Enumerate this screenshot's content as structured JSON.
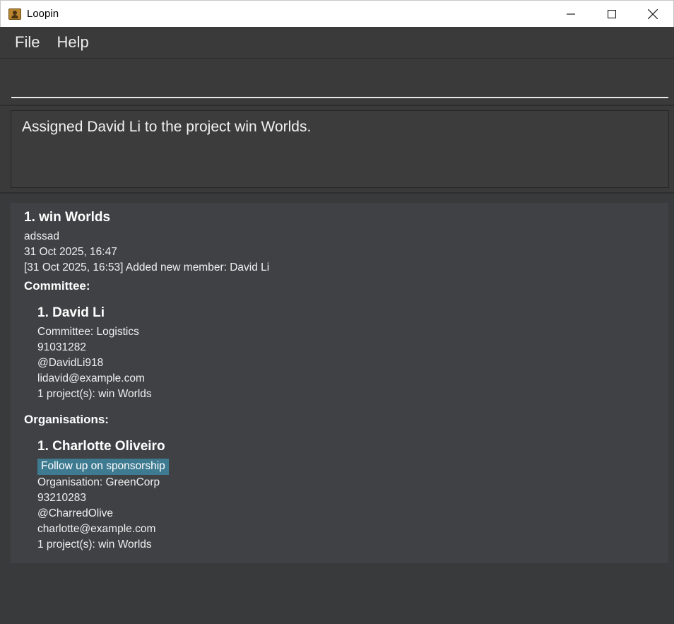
{
  "window": {
    "title": "Loopin",
    "app_icon": "contacts-book-icon"
  },
  "menu": {
    "file": "File",
    "help": "Help"
  },
  "command": {
    "value": "",
    "placeholder": ""
  },
  "result": {
    "text": "Assigned David Li to the project win Worlds."
  },
  "project": {
    "title": "1. win Worlds",
    "description": "adssad",
    "deadline": "31 Oct 2025, 16:47",
    "log": "[31 Oct 2025, 16:53] Added new member: David Li",
    "committee_heading": "Committee:",
    "committee": [
      {
        "name": "1. David Li",
        "role": "Committee: Logistics",
        "phone": "91031282",
        "telegram": "@DavidLi918",
        "email": "lidavid@example.com",
        "projects": "1 project(s): win Worlds"
      }
    ],
    "organisations_heading": "Organisations:",
    "organisations": [
      {
        "name": "1. Charlotte Oliveiro",
        "tag": "Follow up on sponsorship",
        "org": "Organisation: GreenCorp",
        "phone": "93210283",
        "telegram": "@CharredOlive",
        "email": "charlotte@example.com",
        "projects": "1 project(s): win Worlds"
      }
    ]
  },
  "colors": {
    "tag_bg": "#3e7b91",
    "card_bg": "#404145",
    "panel_bg": "#3a3a3a"
  }
}
